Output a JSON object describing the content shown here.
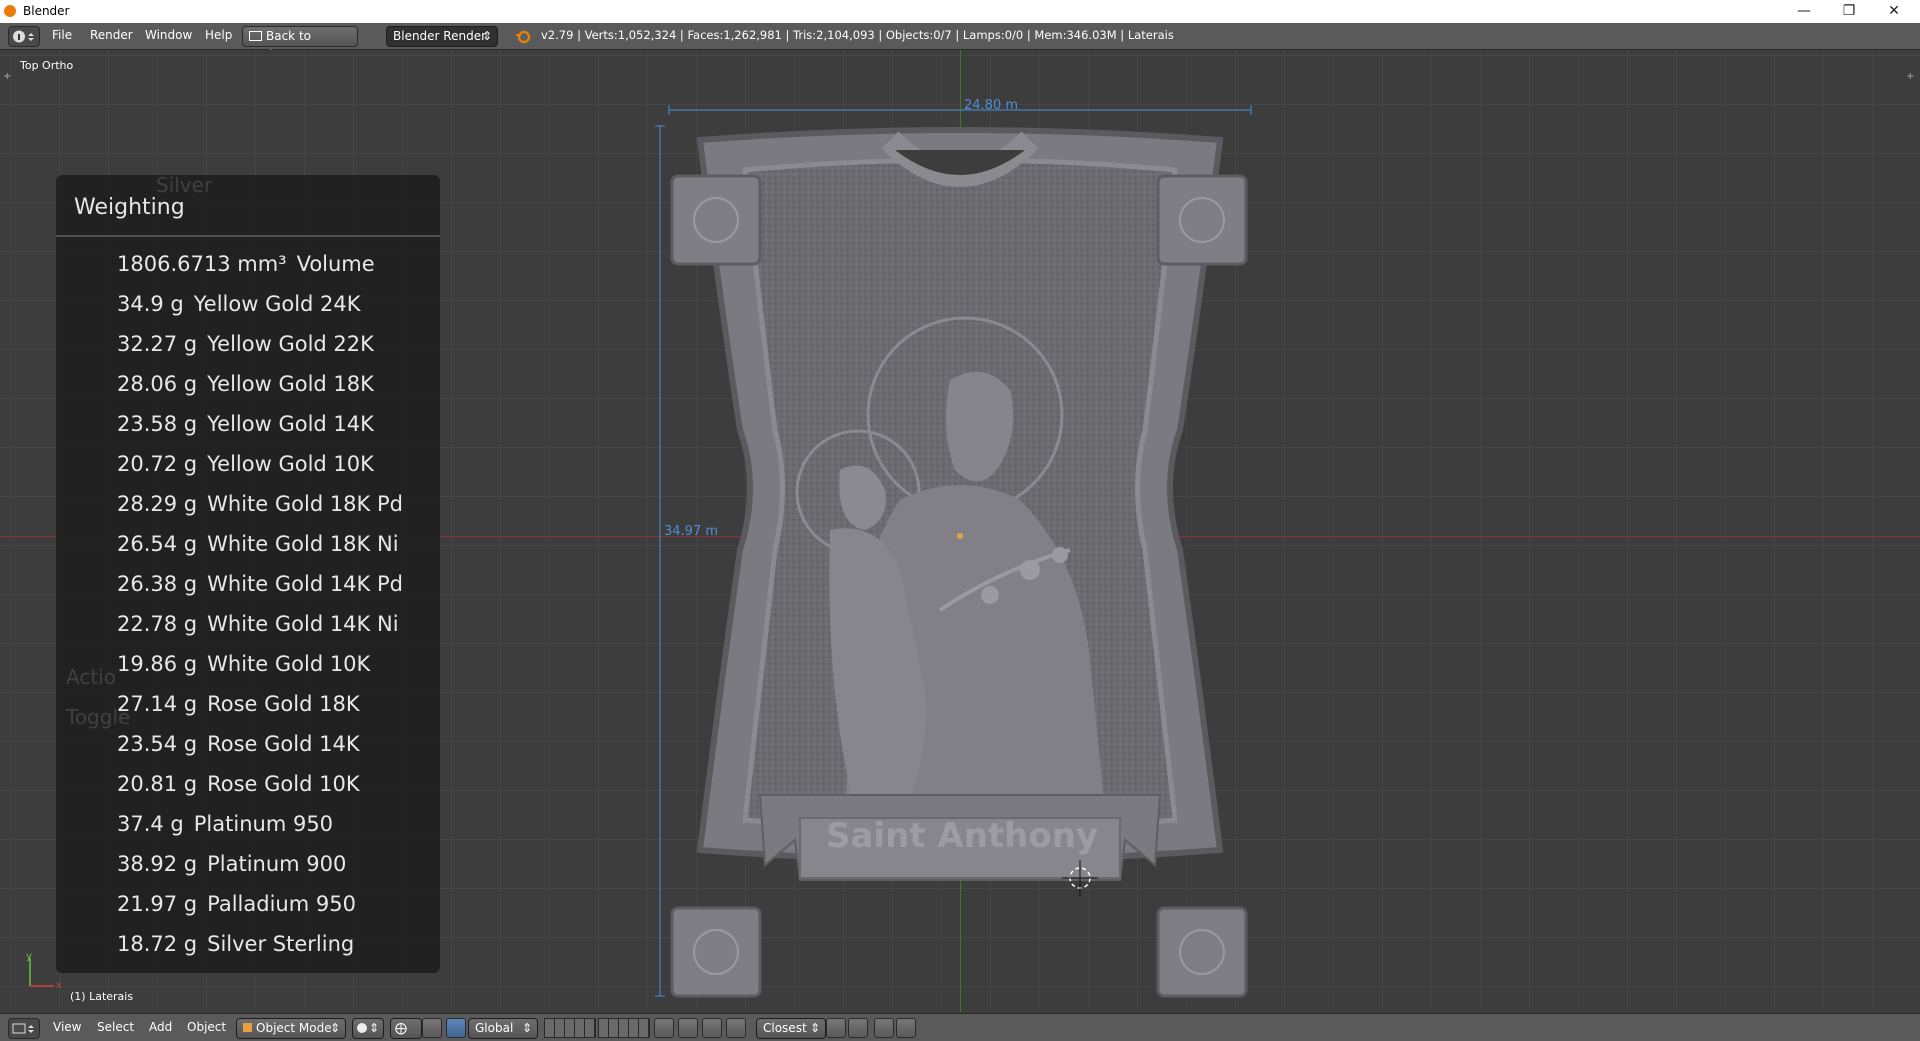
{
  "window": {
    "title": "Blender"
  },
  "info_header": {
    "menus": [
      "File",
      "Render",
      "Window",
      "Help"
    ],
    "back_button": "Back to Previous",
    "engine": "Blender Render",
    "stats": "v2.79 | Verts:1,052,324 | Faces:1,262,981 | Tris:2,104,093 | Objects:0/7 | Lamps:0/0 | Mem:346.03M | Laterais"
  },
  "viewport": {
    "view_name": "Top Ortho",
    "object_label": "(1) Laterais",
    "dimensions": {
      "width": "24.80 m",
      "height": "34.97 m"
    },
    "plaque_text": "Saint Anthony"
  },
  "weighting": {
    "title": "Weighting",
    "ghost_texts": [
      "Silver",
      "Actio",
      "Toggle"
    ],
    "volume": {
      "value": "1806.6713 mm³",
      "label": "Volume"
    },
    "rows": [
      {
        "weight": "34.9 g",
        "metal": "Yellow Gold 24K"
      },
      {
        "weight": "32.27 g",
        "metal": "Yellow Gold 22K"
      },
      {
        "weight": "28.06 g",
        "metal": "Yellow Gold 18K"
      },
      {
        "weight": "23.58 g",
        "metal": "Yellow Gold 14K"
      },
      {
        "weight": "20.72 g",
        "metal": "Yellow Gold 10K"
      },
      {
        "weight": "28.29 g",
        "metal": "White Gold 18K Pd"
      },
      {
        "weight": "26.54 g",
        "metal": "White Gold 18K Ni"
      },
      {
        "weight": "26.38 g",
        "metal": "White Gold 14K Pd"
      },
      {
        "weight": "22.78 g",
        "metal": "White Gold 14K Ni"
      },
      {
        "weight": "19.86 g",
        "metal": "White Gold 10K"
      },
      {
        "weight": "27.14 g",
        "metal": "Rose Gold 18K"
      },
      {
        "weight": "23.54 g",
        "metal": "Rose Gold 14K"
      },
      {
        "weight": "20.81 g",
        "metal": "Rose Gold 10K"
      },
      {
        "weight": "37.4 g",
        "metal": "Platinum 950"
      },
      {
        "weight": "38.92 g",
        "metal": "Platinum 900"
      },
      {
        "weight": "21.97 g",
        "metal": "Palladium 950"
      },
      {
        "weight": "18.72 g",
        "metal": "Silver Sterling"
      }
    ]
  },
  "bottom_header": {
    "menus": [
      "View",
      "Select",
      "Add",
      "Object"
    ],
    "mode": "Object Mode",
    "orientation": "Global",
    "snap_target": "Closest"
  },
  "colors": {
    "accent_orange": "#e87d0d",
    "dimension_blue": "#4b8fd6",
    "x_axis": "#8a3535",
    "y_axis": "#3f7a2f"
  }
}
